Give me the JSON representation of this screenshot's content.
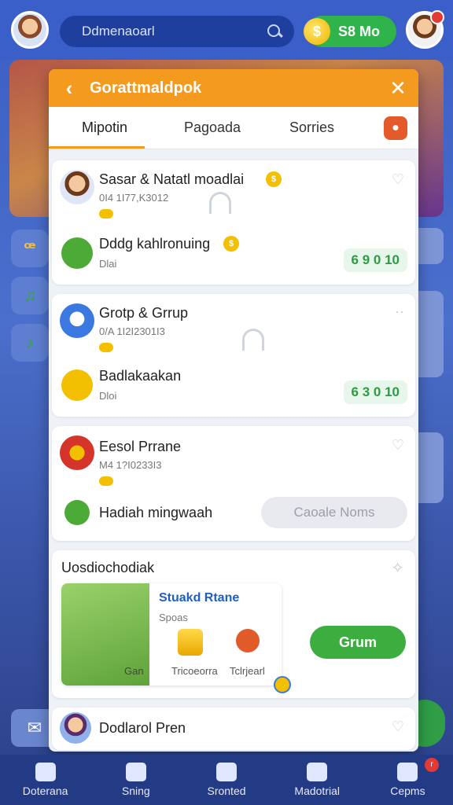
{
  "search": {
    "value": "Ddmenaoarl"
  },
  "wallet": {
    "amount": "S8 Mo"
  },
  "modal": {
    "title": "Gorattmaldpok",
    "tabs": [
      {
        "label": "Mipotin",
        "active": true
      },
      {
        "label": "Pagoada",
        "active": false
      },
      {
        "label": "Sorries",
        "active": false
      }
    ],
    "rows": [
      {
        "title": "Sasar & Natatl moadlai",
        "sub": "0I4 1I77,K3012"
      },
      {
        "title": "Dddg kahlronuing",
        "sub": "Dlai",
        "reward": "6 9 0 10"
      },
      {
        "title": "Grotp & Grrup",
        "sub": "0/A 1I2I2301I3"
      },
      {
        "title": "Badlakaakan",
        "sub": "Dloi",
        "reward": "6 3 0 10"
      },
      {
        "title": "Eesol Prrane",
        "sub": "M4 1?I0233I3"
      },
      {
        "title": "Hadiah mingwaah",
        "button": "Caoale Noms"
      }
    ],
    "promo": {
      "section_title": "Uosdiochodiak",
      "name": "Stuakd Rtane",
      "sub": "Spoas",
      "art_label": "Gan",
      "item1_label": "Tricoeorra",
      "item2_label": "Tclrjearl",
      "cta": "Grum"
    },
    "last_row": {
      "title": "Dodlarol Pren"
    }
  },
  "bottom_nav": [
    {
      "label": "Doterana"
    },
    {
      "label": "Sning"
    },
    {
      "label": "Sronted"
    },
    {
      "label": "Madotrial"
    },
    {
      "label": "Cepms",
      "badge": "r"
    }
  ]
}
